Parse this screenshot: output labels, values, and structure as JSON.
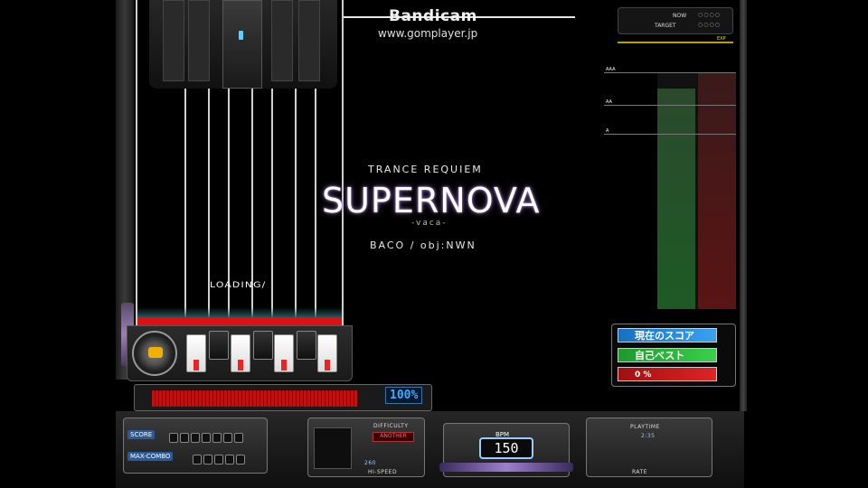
{
  "watermark": {
    "title": "Bandicam",
    "url": "www.gomplayer.jp"
  },
  "song": {
    "genre": "TRANCE REQUIEM",
    "title": "SUPERNOVA",
    "subtitle": "-vaca-",
    "artist": "BACO / obj:NWN"
  },
  "lane": {
    "loading_text": "LOADING/"
  },
  "gauge": {
    "percent_label": "100%",
    "fill": 1.0
  },
  "score_panel": {
    "score_label": "SCORE",
    "max_combo_label": "MAX-COMBO"
  },
  "info_panel": {
    "difficulty_label": "DIFFICULTY",
    "difficulty_value": "ANOTHER",
    "speed_value": "260",
    "hi_speed_label": "HI-SPEED",
    "bpm_label": "BPM",
    "bpm_value": "150",
    "playtime_label": "PLAYTIME",
    "playtime_value": "2:35",
    "rate_label": "RATE"
  },
  "graph": {
    "header_now_label": "NOW",
    "header_target_label": "TARGET",
    "target_tag": "EXP",
    "grid_labels": [
      "AAA",
      "AA",
      "A"
    ],
    "now_level": 0.93,
    "target_level": 1.0
  },
  "legend": {
    "now_score": "現在のスコア",
    "personal_best": "自己ベスト",
    "percent": "0 %"
  },
  "colors": {
    "now_bar": "#1e5a24",
    "target_bar": "#5a1414",
    "gauge": "#c01010",
    "title_glow": "#8a6cc0"
  }
}
